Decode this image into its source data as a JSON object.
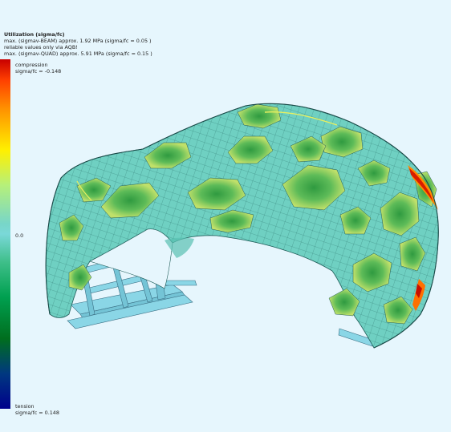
{
  "legend": {
    "title": "Utilization (sigma/fc)",
    "line1": "max. (sigmav-BEAM) approx. 1.92 MPa (sigma/fc = 0.05 )",
    "line2": "reliable values only via AQB!",
    "line3": "max. (sigmav-QUAD) approx. 5.91 MPa (sigma/fc = 0.15 )"
  },
  "colorbar": {
    "top_label": "compression",
    "top_value": "sigma/fc = -0.148",
    "mid_value": "0.0",
    "bottom_label": "tension",
    "bottom_value": "sigma/fc = 0.148",
    "colors": [
      "#c80000",
      "#ff9000",
      "#fff000",
      "#7ad8d8",
      "#00a050",
      "#00008c"
    ]
  },
  "model": {
    "shell_color": "#66ccbb",
    "patch_color": "#3fb070",
    "frame_color": "#7cd0e0"
  }
}
